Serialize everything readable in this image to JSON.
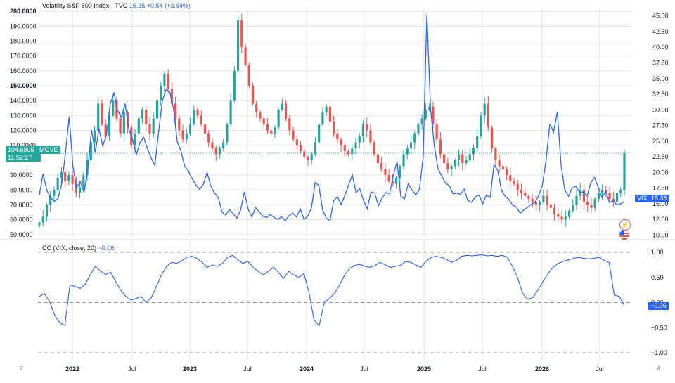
{
  "header": {
    "title": "Volatility S&P 500 Index · TVC",
    "last": "15.36",
    "change": "+0.54 (+3.64%)"
  },
  "indicator": {
    "label": "CC (VIX, close, 20)",
    "value": "−0.06"
  },
  "price_tags": {
    "move_value": "104.6805",
    "move_time": "11:52:27",
    "move_label": "MOVE",
    "vix_label": "VIX",
    "vix_value": "15.36",
    "cc_value": "−0.06"
  },
  "corners": {
    "left": "Z",
    "right": "A"
  },
  "icons": {
    "flash": "lightning-icon",
    "flag": "us-flag-icon"
  },
  "colors": {
    "up": "#26a69a",
    "down": "#ef5350",
    "vix_line": "#2962ff",
    "move_tag": "#26a69a",
    "vix_tag": "#2962ff",
    "cc_line": "#2962ff",
    "grid": "#e0e3eb"
  },
  "chart_data": [
    {
      "type": "line",
      "x_ticks": [
        "2022",
        "Jul",
        "2023",
        "Jul",
        "2024",
        "Jul",
        "2025",
        "Jul",
        "2026",
        "Jul"
      ],
      "left_axis": {
        "ticks": [
          "200.0000",
          "190.0000",
          "180.0000",
          "170.0000",
          "160.0000",
          "150.0000",
          "140.0000",
          "130.0000",
          "120.0000",
          "110.0000",
          "90.0000",
          "80.0000",
          "70.0000",
          "60.0000",
          "50.0000"
        ],
        "range": [
          48,
          202
        ]
      },
      "right_axis": {
        "ticks": [
          "45.00",
          "42.50",
          "40.00",
          "37.50",
          "35.00",
          "32.50",
          "30.00",
          "27.50",
          "25.00",
          "22.50",
          "20.00",
          "17.50",
          "15.00",
          "12.50",
          "10.00"
        ],
        "range": [
          9.6,
          46.2
        ]
      },
      "series": [
        {
          "name": "MOVE",
          "style": "candlestick",
          "axis": "left",
          "last_value": 104.6805,
          "closes": [
            58,
            62,
            70,
            76,
            80,
            88,
            92,
            86,
            90,
            84,
            78,
            82,
            90,
            100,
            112,
            120,
            138,
            124,
            116,
            130,
            140,
            128,
            118,
            132,
            122,
            110,
            118,
            128,
            134,
            124,
            118,
            128,
            140,
            150,
            158,
            148,
            138,
            128,
            120,
            114,
            118,
            124,
            134,
            130,
            124,
            118,
            112,
            108,
            104,
            108,
            112,
            124,
            140,
            160,
            194,
            176,
            164,
            150,
            138,
            132,
            128,
            124,
            120,
            118,
            122,
            134,
            138,
            128,
            120,
            114,
            110,
            106,
            102,
            100,
            104,
            112,
            124,
            132,
            136,
            126,
            118,
            114,
            110,
            106,
            104,
            108,
            112,
            116,
            124,
            120,
            112,
            104,
            98,
            94,
            90,
            86,
            84,
            88,
            96,
            104,
            108,
            112,
            118,
            124,
            128,
            134,
            136,
            124,
            114,
            104,
            98,
            94,
            96,
            100,
            104,
            98,
            100,
            104,
            108,
            116,
            130,
            138,
            122,
            108,
            100,
            96,
            94,
            90,
            86,
            84,
            80,
            78,
            76,
            74,
            72,
            70,
            72,
            76,
            70,
            68,
            64,
            62,
            60,
            62,
            66,
            70,
            76,
            80,
            72,
            70,
            68,
            74,
            78,
            80,
            78,
            74,
            72,
            78,
            80,
            104.7
          ]
        },
        {
          "name": "VIX",
          "style": "line",
          "axis": "right",
          "last_value": 15.36,
          "closes": [
            16.4,
            19.8,
            17.1,
            16.0,
            15.4,
            15.8,
            18.2,
            23.1,
            28.9,
            21.0,
            17.6,
            18.5,
            16.8,
            20.6,
            26.8,
            23.2,
            27.0,
            24.2,
            26.0,
            30.9,
            32.7,
            29.9,
            28.8,
            31.0,
            26.9,
            25.3,
            22.8,
            24.8,
            25.6,
            23.8,
            22.3,
            21.1,
            26.5,
            31.4,
            33.3,
            32.8,
            30.2,
            24.9,
            23.4,
            21.0,
            20.2,
            19.0,
            18.0,
            17.3,
            18.1,
            20.0,
            17.8,
            16.7,
            16.0,
            13.7,
            13.2,
            14.1,
            13.4,
            12.7,
            14.0,
            16.9,
            14.2,
            12.9,
            14.4,
            13.7,
            13.0,
            12.8,
            13.3,
            12.8,
            12.5,
            12.9,
            12.3,
            13.1,
            13.5,
            12.9,
            14.2,
            12.5,
            13.0,
            14.3,
            18.4,
            17.9,
            14.0,
            12.7,
            12.3,
            15.5,
            16.1,
            14.9,
            16.3,
            18.0,
            19.6,
            16.8,
            17.4,
            15.5,
            14.2,
            16.9,
            16.7,
            14.7,
            15.9,
            16.8,
            16.6,
            19.5,
            21.7,
            16.2,
            15.8,
            18.2,
            17.2,
            16.4,
            17.3,
            22.4,
            45.3,
            30.1,
            24.2,
            20.6,
            19.4,
            18.3,
            17.9,
            16.6,
            16.7,
            16.5,
            17.3,
            15.5,
            15.2,
            16.1,
            16.4,
            15.0,
            16.4,
            16.0,
            21.2,
            20.4,
            17.2,
            16.2,
            15.7,
            14.8,
            14.5,
            13.5,
            14.0,
            14.4,
            14.9,
            15.2,
            16.3,
            18.0,
            22.0,
            27.8,
            26.4,
            29.7,
            21.3,
            17.2,
            16.2,
            17.5,
            17.8,
            16.8,
            16.9,
            16.2,
            18.4,
            19.2,
            17.6,
            16.0,
            17.0,
            15.2,
            15.5,
            14.8,
            15.0,
            15.36
          ]
        }
      ]
    },
    {
      "type": "line",
      "title": "CC (VIX, close, 20)",
      "y_ticks": [
        "1.00",
        "0.50",
        "0.00",
        "−0.50",
        "−1.00"
      ],
      "ylim": [
        -1.0,
        1.0
      ],
      "series": [
        {
          "name": "CC",
          "last_value": -0.06,
          "values": [
            0.12,
            0.18,
            0.02,
            -0.25,
            -0.4,
            -0.46,
            0.35,
            0.32,
            0.28,
            0.36,
            0.55,
            0.72,
            0.63,
            0.56,
            0.6,
            0.42,
            0.24,
            0.12,
            0.05,
            0.08,
            0.12,
            0.0,
            0.1,
            0.32,
            0.55,
            0.72,
            0.8,
            0.78,
            0.83,
            0.9,
            0.92,
            0.88,
            0.8,
            0.7,
            0.75,
            0.72,
            0.78,
            0.9,
            0.94,
            0.85,
            0.78,
            0.82,
            0.7,
            0.62,
            0.55,
            0.62,
            0.7,
            0.6,
            0.48,
            0.62,
            0.55,
            0.5,
            0.58,
            0.2,
            -0.35,
            -0.46,
            0.0,
            0.08,
            0.18,
            0.35,
            0.55,
            0.68,
            0.74,
            0.76,
            0.72,
            0.7,
            0.74,
            0.8,
            0.75,
            0.7,
            0.72,
            0.74,
            0.82,
            0.8,
            0.75,
            0.7,
            0.82,
            0.9,
            0.92,
            0.9,
            0.86,
            0.8,
            0.84,
            0.92,
            0.94,
            0.93,
            0.94,
            0.95,
            0.93,
            0.94,
            0.92,
            0.94,
            0.9,
            0.72,
            0.5,
            0.18,
            0.06,
            0.1,
            0.25,
            0.42,
            0.58,
            0.7,
            0.78,
            0.82,
            0.85,
            0.88,
            0.9,
            0.88,
            0.87,
            0.88,
            0.9,
            0.84,
            0.8,
            0.15,
            0.12,
            -0.06
          ]
        }
      ]
    }
  ]
}
